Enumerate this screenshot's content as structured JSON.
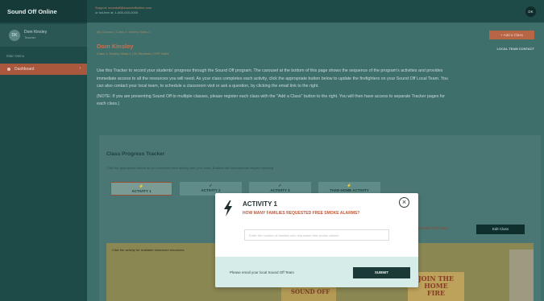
{
  "app": {
    "title": "Sound Off Online"
  },
  "user": {
    "initials": "DK",
    "name": "Dom Kinsley",
    "role": "Teacher"
  },
  "sidebar": {
    "menu_heading": "Main Menu",
    "items": [
      {
        "label": "Dashboard"
      }
    ]
  },
  "topbar": {
    "support": "Support: soundoff@soundoffonline.com",
    "phone": "or toll-free at: 1-800-000-0000",
    "avatar_initials": "DK"
  },
  "main": {
    "breadcrumb": "My Classes | Class 1: Kinsley Klass 1",
    "teacher_name": "Dom Kinsley",
    "class_info": "Class 1: Kinsley Klass 1 | 20 Students | 3 FF Visits",
    "add_class_label": "+ Add a Class",
    "local_team_label": "LOCAL TEAM CONTACT",
    "intro_paragraph_1": "Use this Tracker to record your students' progress through the Sound Off program. The carousel at the bottom of this page shows the sequence of the program's activities and provides immediate access to all the resources you will need. As your class completes each activity, click the appropriate button below to update the firefighters on your Sound Off Local Team. You can also contact your local team, to schedule a classroom visit or ask a question, by clicking the email link to the right.",
    "intro_paragraph_2": "(NOTE: If you are presenting Sound Off to multiple classes, please register each class with the \"Add a Class\" button to the right. You will then have access to separate Tracker pages for each class.)"
  },
  "tracker": {
    "title": "Class Progress Tracker",
    "help": "Click the appropriate button as you complete each activity with your class. Buttons with thunderbolts require reporting.",
    "tabs": [
      {
        "label": "ACTIVITY 1",
        "symbol": "⚡"
      },
      {
        "label": "ACTIVITY 2",
        "symbol": "✓"
      },
      {
        "label": "ACTIVITY 3",
        "symbol": "✓"
      },
      {
        "label": "TAKE-HOME ACTIVITY",
        "symbol": "⚡"
      }
    ],
    "delete_label": "Delete this Class",
    "edit_label": "Edit Class",
    "panel_help": "Click the activity for available classroom resources.",
    "poster_1_text": "SOUND OFF",
    "poster_2_text": "JOIN THE HOME FIRE"
  },
  "modal": {
    "title": "ACTIVITY 1",
    "question": "HOW MANY FAMILIES REQUESTED FREE SMOKE ALARMS?",
    "input_placeholder": "Enter the number of families who requested free smoke alarms",
    "email_link": "Please email your local Sound Off Team",
    "submit_label": "SUBMIT",
    "close_glyph": "×"
  },
  "colors": {
    "accent": "#c0593a",
    "dark_teal": "#1a3937",
    "overlay_teal": "#3f6f6b",
    "modal_footer": "#d5ece8"
  }
}
